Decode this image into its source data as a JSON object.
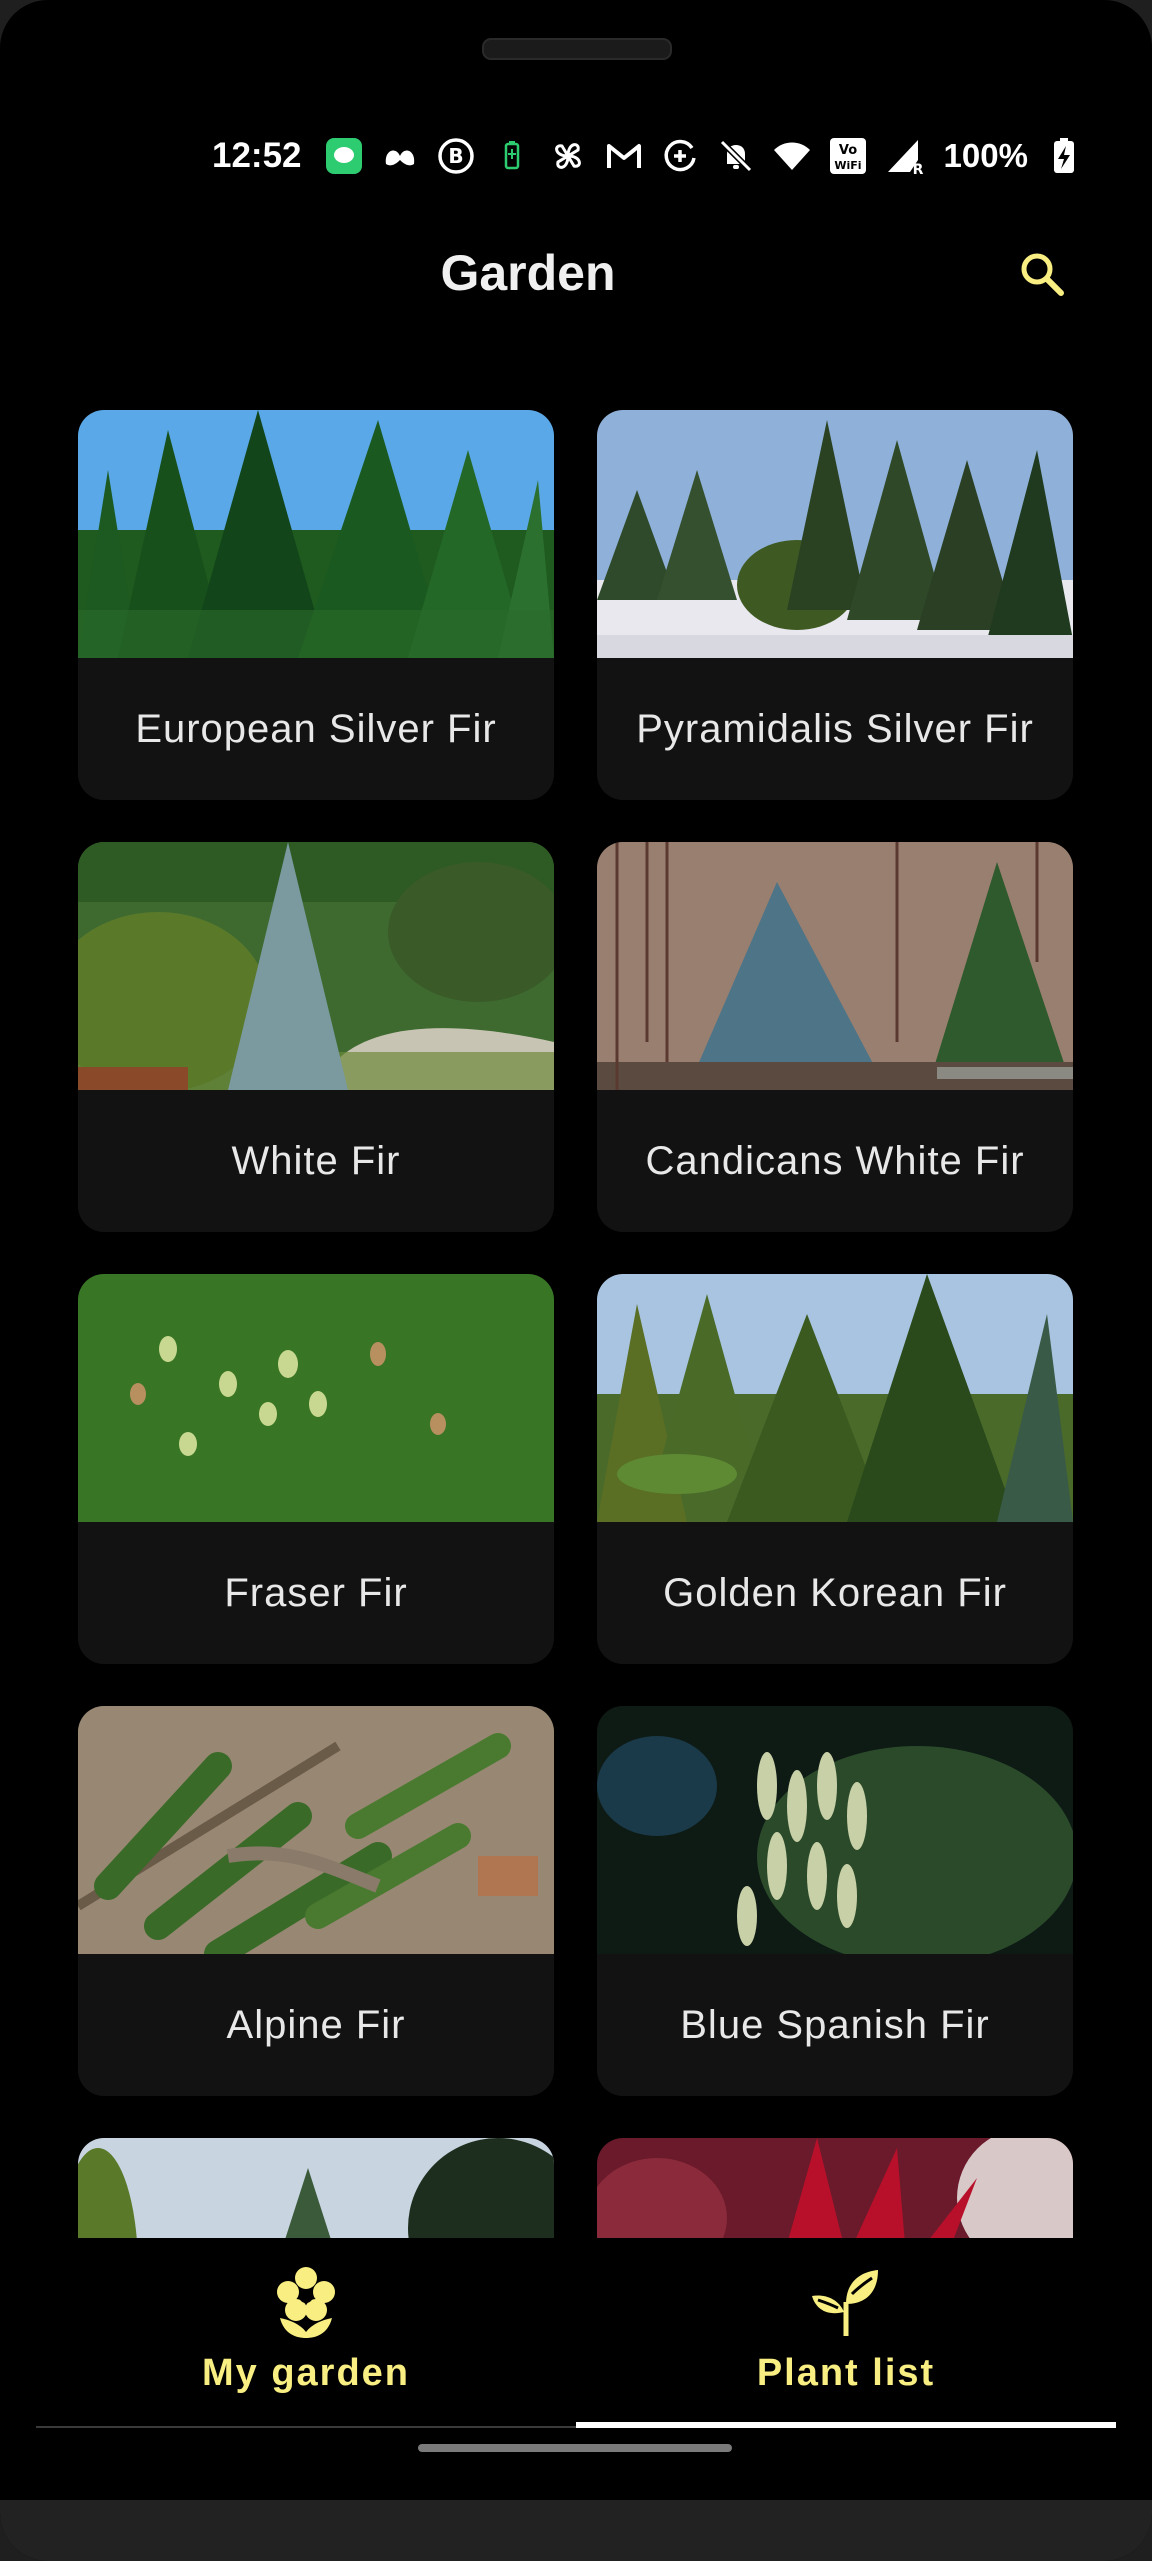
{
  "status_bar": {
    "time": "12:52",
    "battery_percent": "100%",
    "icons": [
      "chat-app-icon",
      "butterfly-app-icon",
      "b-app-icon",
      "battery-saver-icon",
      "pinwheel-app-icon",
      "gmail-icon",
      "add-circle-icon",
      "bell-off-icon",
      "wifi-icon",
      "vowifi-icon",
      "signal-icon",
      "battery-charging-icon"
    ],
    "vowifi_label_top": "Vo",
    "vowifi_label_bottom": "WiFi",
    "signal_label": "R"
  },
  "app_bar": {
    "title": "Garden",
    "search_icon": "search-icon",
    "accent_color": "#f8ee82"
  },
  "plants": [
    {
      "name": "European Silver Fir"
    },
    {
      "name": "Pyramidalis Silver Fir"
    },
    {
      "name": "White Fir"
    },
    {
      "name": "Candicans White Fir"
    },
    {
      "name": "Fraser Fir"
    },
    {
      "name": "Golden Korean Fir"
    },
    {
      "name": "Alpine Fir"
    },
    {
      "name": "Blue Spanish Fir"
    },
    {
      "name": ""
    },
    {
      "name": ""
    }
  ],
  "bottom_nav": {
    "items": [
      {
        "label": "My garden",
        "icon": "flower-icon",
        "selected": false
      },
      {
        "label": "Plant list",
        "icon": "sprout-icon",
        "selected": true
      }
    ]
  }
}
